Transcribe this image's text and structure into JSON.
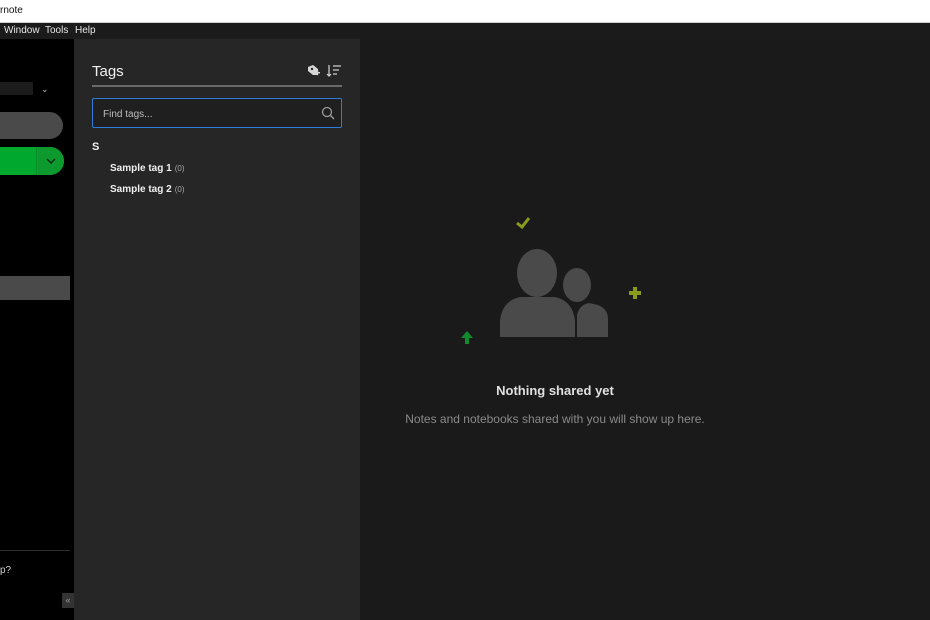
{
  "window": {
    "title": "rnote"
  },
  "menu": [
    "Window",
    "Tools",
    "Help"
  ],
  "sidebar": {
    "help_text": "p?",
    "collapse_glyph": "«"
  },
  "tags_panel": {
    "title": "Tags",
    "search_placeholder": "Find tags...",
    "groups": [
      {
        "letter": "S",
        "tags": [
          {
            "name": "Sample tag 1",
            "count": "(0)"
          },
          {
            "name": "Sample tag 2",
            "count": "(0)"
          }
        ]
      }
    ],
    "icons": [
      "add-tag-icon",
      "sort-icon",
      "search-icon"
    ]
  },
  "main": {
    "empty_title": "Nothing shared yet",
    "empty_subtitle": "Notes and notebooks shared with you will show up here.",
    "illustration_icons": [
      "people-icon",
      "check-icon",
      "plus-icon",
      "arrow-up-icon"
    ]
  },
  "colors": {
    "accent_green": "#00a82d",
    "focus_blue": "#2f7bd9",
    "olive": "#8a9a1a"
  }
}
